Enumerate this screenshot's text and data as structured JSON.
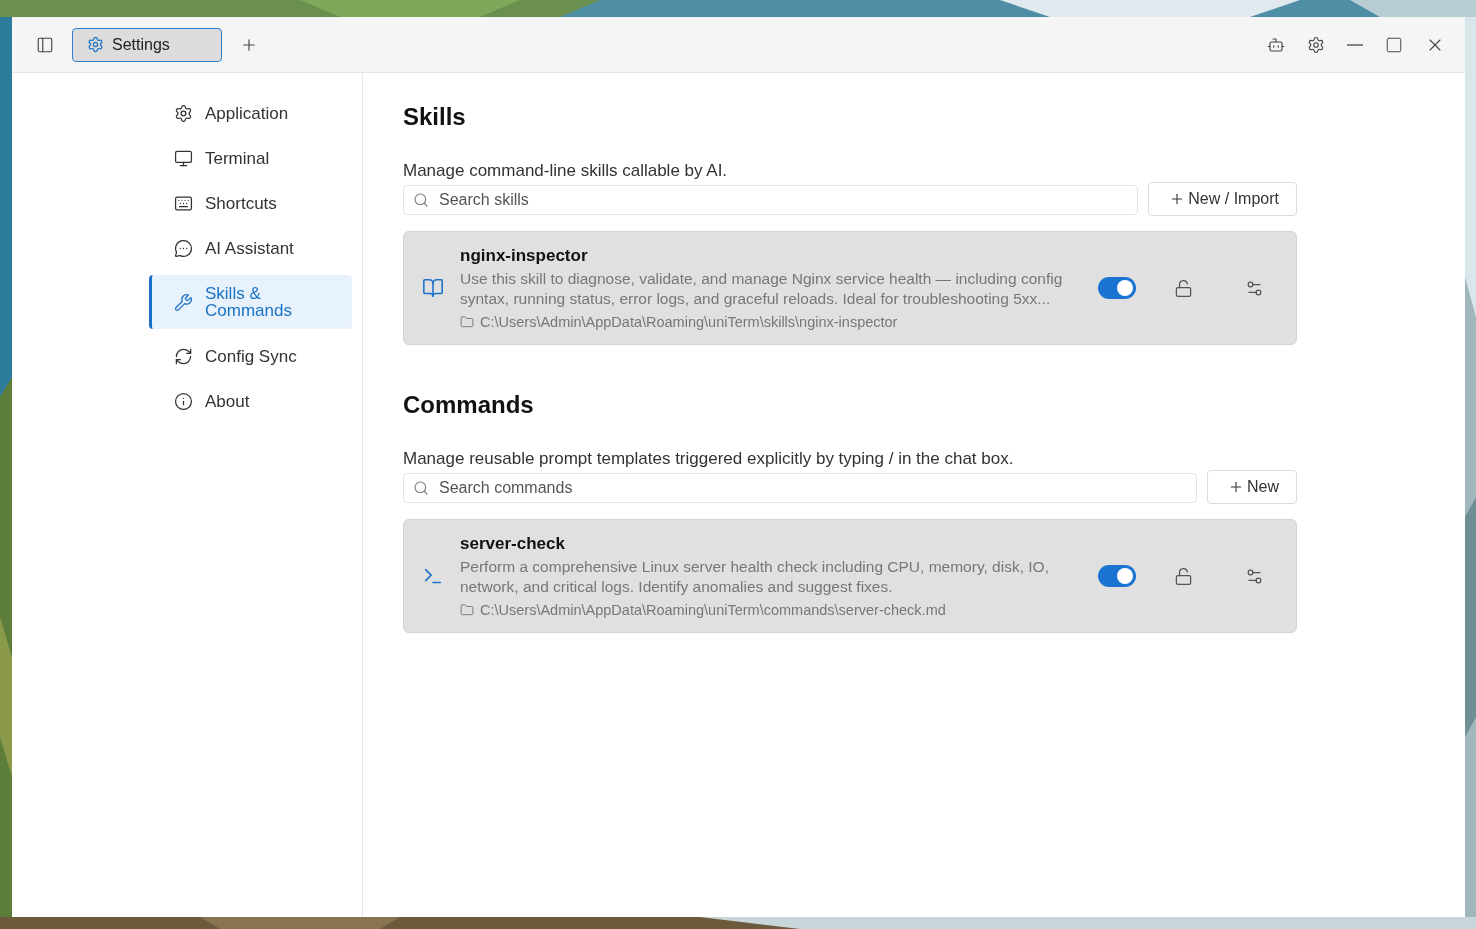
{
  "titlebar": {
    "tabs": [
      {
        "label": "Settings",
        "selected": true
      }
    ]
  },
  "sidebar": {
    "items": [
      {
        "label": "Application",
        "selected": false
      },
      {
        "label": "Terminal",
        "selected": false
      },
      {
        "label": "Shortcuts",
        "selected": false
      },
      {
        "label": "AI Assistant",
        "selected": false
      },
      {
        "label": "Skills & Commands",
        "selected": true
      },
      {
        "label": "Config Sync",
        "selected": false
      },
      {
        "label": "About",
        "selected": false
      }
    ]
  },
  "sections": [
    {
      "title": "Skills",
      "description": "Manage command-line skills callable by AI.",
      "search": {
        "placeholder": "Search skills"
      },
      "button": "New / Import",
      "items": [
        {
          "kind": "skill",
          "name": "nginx-inspector",
          "description": "Use this skill to diagnose, validate, and manage Nginx service health — including config syntax, running status, error logs, and graceful reloads. Ideal for troubleshooting 5xx...",
          "path": "C:\\Users\\Admin\\AppData\\Roaming\\uniTerm\\skills\\nginx-inspector",
          "enabled": true
        }
      ]
    },
    {
      "title": "Commands",
      "description": "Manage reusable prompt templates triggered explicitly by typing / in the chat box.",
      "search": {
        "placeholder": "Search commands"
      },
      "button": "New",
      "items": [
        {
          "kind": "command",
          "name": "server-check",
          "description": "Perform a comprehensive Linux server health check including CPU, memory, disk, IO, network, and critical logs. Identify anomalies and suggest fixes.",
          "path": "C:\\Users\\Admin\\AppData\\Roaming\\uniTerm\\commands\\server-check.md",
          "enabled": true
        }
      ]
    }
  ]
}
